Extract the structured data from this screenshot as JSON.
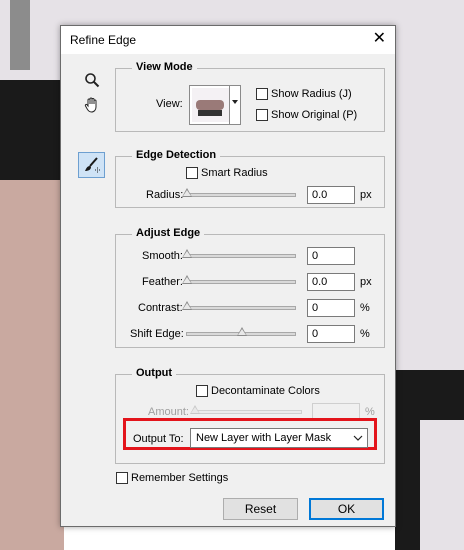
{
  "dialog": {
    "title": "Refine Edge",
    "close_glyph": "✕"
  },
  "tools": [
    {
      "name": "zoom-tool",
      "icon": "magnifier-icon"
    },
    {
      "name": "hand-tool",
      "icon": "hand-icon"
    },
    {
      "name": "refine-radius-tool",
      "icon": "brush-icon"
    }
  ],
  "view_mode": {
    "legend": "View Mode",
    "view_label": "View:",
    "show_radius": "Show Radius (J)",
    "show_original": "Show Original (P)"
  },
  "edge_detection": {
    "legend": "Edge Detection",
    "smart_radius": "Smart Radius",
    "radius_label": "Radius:",
    "radius_value": "0.0",
    "radius_unit": "px"
  },
  "adjust_edge": {
    "legend": "Adjust Edge",
    "smooth_label": "Smooth:",
    "smooth_value": "0",
    "feather_label": "Feather:",
    "feather_value": "0.0",
    "feather_unit": "px",
    "contrast_label": "Contrast:",
    "contrast_value": "0",
    "contrast_unit": "%",
    "shift_label": "Shift Edge:",
    "shift_value": "0",
    "shift_unit": "%"
  },
  "output": {
    "legend": "Output",
    "decontaminate": "Decontaminate Colors",
    "amount_label": "Amount:",
    "amount_unit": "%",
    "output_to_label": "Output To:",
    "output_to_value": "New Layer with Layer Mask"
  },
  "footer": {
    "remember": "Remember Settings",
    "reset": "Reset",
    "ok": "OK"
  },
  "colors": {
    "highlight": "#e3141b",
    "default_button_border": "#0078d7"
  }
}
